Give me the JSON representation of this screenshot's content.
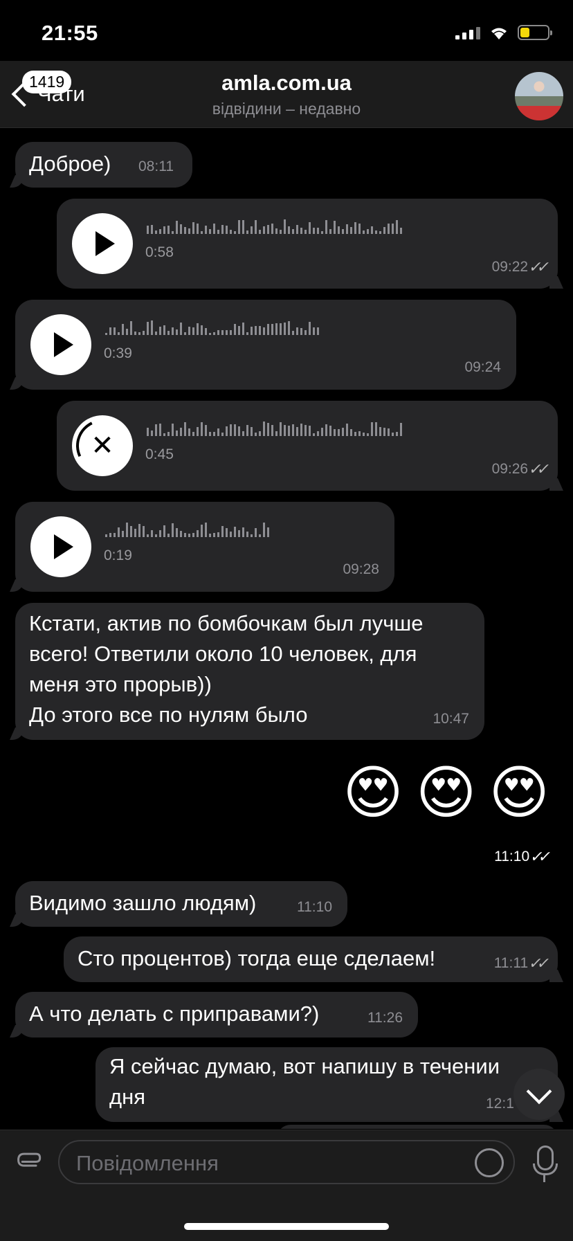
{
  "status": {
    "time": "21:55",
    "battery_level": 0.3
  },
  "header": {
    "back_label": "Чати",
    "badge": "1419",
    "title": "amla.com.ua",
    "subtitle": "відвідини – недавно"
  },
  "messages": [
    {
      "text": "Доброе)",
      "time": "08:11"
    },
    {
      "duration": "0:58",
      "time": "09:22"
    },
    {
      "duration": "0:39",
      "time": "09:24"
    },
    {
      "duration": "0:45",
      "time": "09:26"
    },
    {
      "duration": "0:19",
      "time": "09:28"
    },
    {
      "text": "Кстати, актив по бомбочкам был лучше\nвсего! Ответили около 10 человек, для\nменя это прорыв))\nДо этого все по нулям было",
      "time": "10:47"
    },
    {
      "emoji": "😍",
      "time": "11:10"
    },
    {
      "text": "Видимо зашло людям)",
      "time": "11:10"
    },
    {
      "text": "Сто процентов) тогда еще сделаем!",
      "time": "11:11"
    },
    {
      "text": "А что делать с приправами?)",
      "time": "11:26"
    },
    {
      "text": "Я сейчас думаю, вот напишу в течении\nдня",
      "time": "12:1"
    }
  ],
  "input": {
    "placeholder": "Повідомлення"
  },
  "icons": [
    "back-chevron-icon",
    "signal-icon",
    "wifi-icon",
    "battery-icon",
    "play-icon",
    "cancel-download-icon",
    "double-check-icon",
    "attach-icon",
    "sticker-icon",
    "microphone-icon",
    "scroll-down-icon"
  ],
  "colors": {
    "background": "#000000",
    "bubble": "#262628",
    "secondary_text": "#8e8e93",
    "battery": "#f5d90a"
  }
}
